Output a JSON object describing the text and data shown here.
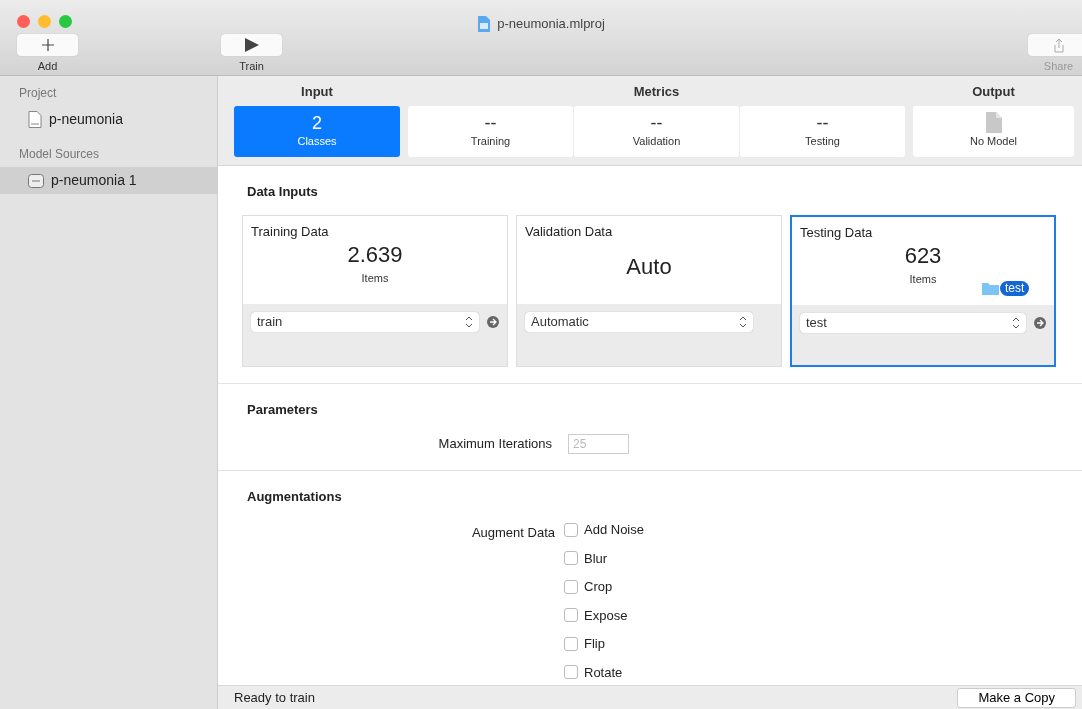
{
  "window": {
    "title": "p-neumonia.mlproj"
  },
  "toolbar": {
    "buttons": [
      {
        "label": "Add",
        "disabled": false
      },
      {
        "label": "Train",
        "disabled": false
      },
      {
        "label": "Share",
        "disabled": true
      }
    ]
  },
  "sidebar": {
    "sections": [
      {
        "heading": "Project",
        "items": [
          {
            "label": "p-neumonia",
            "kind": "project",
            "selected": false
          }
        ]
      },
      {
        "heading": "Model Sources",
        "items": [
          {
            "label": "p-neumonia 1",
            "kind": "source",
            "selected": true
          }
        ]
      }
    ]
  },
  "stages": [
    {
      "heading": "Input",
      "tabs": [
        {
          "kind": "metric",
          "value": "2",
          "label": "Classes",
          "selected": true
        }
      ]
    },
    {
      "heading": "Metrics",
      "tabs": [
        {
          "kind": "metric",
          "value": "--",
          "label": "Training",
          "selected": false
        },
        {
          "kind": "metric",
          "value": "--",
          "label": "Validation",
          "selected": false
        },
        {
          "kind": "metric",
          "value": "--",
          "label": "Testing",
          "selected": false
        }
      ]
    },
    {
      "heading": "Output",
      "tabs": [
        {
          "kind": "file",
          "label": "No Model",
          "selected": false
        }
      ]
    }
  ],
  "data_inputs": {
    "heading": "Data Inputs",
    "cards": [
      {
        "title": "Training Data",
        "value": "2.639",
        "unit": "Items",
        "source": "train",
        "go_button": true,
        "selected": false
      },
      {
        "title": "Validation Data",
        "value": "Auto",
        "source": "Automatic",
        "go_button": false,
        "selected": false
      },
      {
        "title": "Testing Data",
        "value": "623",
        "unit": "Items",
        "source": "test",
        "go_button": true,
        "selected": true,
        "drag_token": "test"
      }
    ]
  },
  "parameters": {
    "heading": "Parameters",
    "fields": [
      {
        "label": "Maximum Iterations",
        "placeholder": "25"
      }
    ]
  },
  "augmentations": {
    "heading": "Augmentations",
    "label": "Augment Data",
    "options": [
      {
        "label": "Add Noise",
        "checked": false
      },
      {
        "label": "Blur",
        "checked": false
      },
      {
        "label": "Crop",
        "checked": false
      },
      {
        "label": "Expose",
        "checked": false
      },
      {
        "label": "Flip",
        "checked": false
      },
      {
        "label": "Rotate",
        "checked": false
      }
    ]
  },
  "status_bar": {
    "text": "Ready to train",
    "button": "Make a Copy"
  }
}
